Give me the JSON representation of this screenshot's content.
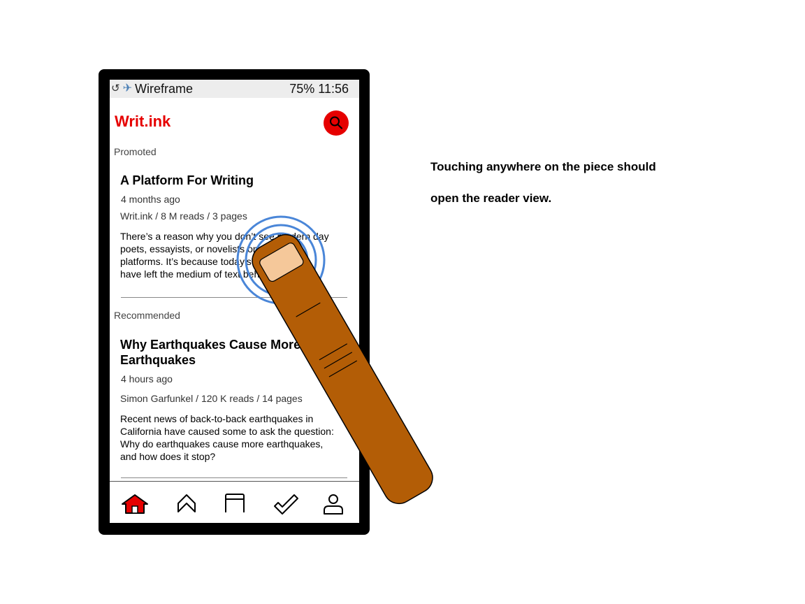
{
  "status_bar": {
    "rotate_icon": "↺",
    "airplane_icon": "✈",
    "carrier": "Wireframe",
    "battery_time": "75% 11:56"
  },
  "header": {
    "brand": "Writ.ink",
    "search_icon": "search-icon",
    "accent_color": "#e60000"
  },
  "sections": {
    "promoted_label": "Promoted",
    "recommended_label": "Recommended"
  },
  "promoted": {
    "title": "A Platform For Writing",
    "time": "4 months ago",
    "meta": "Writ.ink  /  8 M reads  /  3 pages",
    "excerpt_lines": [
      "There’s a reason why you don’t see modern day",
      "poets, essayists, or novelists on digital",
      "platforms. It’s because today’s platforms",
      "have left the medium of text behind."
    ]
  },
  "recommended": {
    "title_lines": [
      "Why Earthquakes Cause More",
      "Earthquakes"
    ],
    "time": "4 hours ago",
    "meta": "Simon Garfunkel  /  120 K reads  /  14 pages",
    "excerpt_lines": [
      "Recent news of back-to-back earthquakes in",
      "California have caused some to ask the question:",
      "Why do earthquakes cause more earthquakes,",
      "and how does it stop?"
    ]
  },
  "bottom_nav": {
    "items": [
      "home-icon",
      "chevron-up-icon",
      "book-icon",
      "check-icon",
      "user-icon"
    ]
  },
  "annotation": {
    "line1": "Touching anywhere on the piece should",
    "line2": "open the reader view."
  }
}
